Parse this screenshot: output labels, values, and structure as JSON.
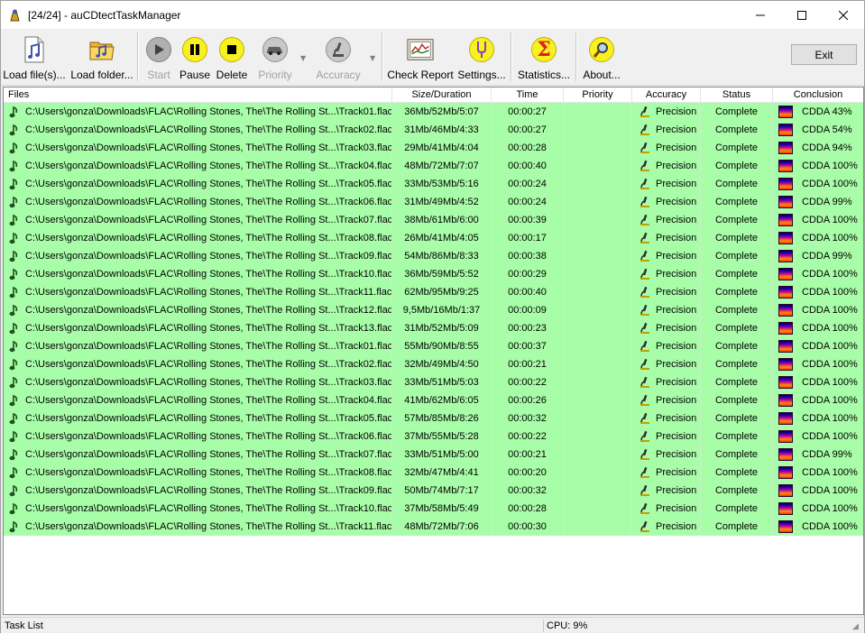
{
  "window": {
    "title": "[24/24] - auCDtectTaskManager",
    "controls": [
      "minimize",
      "maximize",
      "close"
    ]
  },
  "toolbar": {
    "buttons": [
      {
        "label": "Load file(s)...",
        "icon": "music-file-icon",
        "enabled": true
      },
      {
        "label": "Load folder...",
        "icon": "music-folder-icon",
        "enabled": true
      },
      {
        "label": "Start",
        "icon": "play-icon",
        "enabled": false
      },
      {
        "label": "Pause",
        "icon": "pause-icon",
        "enabled": true
      },
      {
        "label": "Delete",
        "icon": "stop-icon",
        "enabled": true
      },
      {
        "label": "Priority",
        "icon": "car-icon",
        "enabled": false
      },
      {
        "label": "Accuracy",
        "icon": "microscope-icon",
        "enabled": false
      },
      {
        "label": "Check Report",
        "icon": "report-icon",
        "enabled": true
      },
      {
        "label": "Settings...",
        "icon": "tuning-fork-icon",
        "enabled": true
      },
      {
        "label": "Statistics...",
        "icon": "sigma-icon",
        "enabled": true
      },
      {
        "label": "About...",
        "icon": "magnifier-icon",
        "enabled": true
      }
    ],
    "exit_label": "Exit"
  },
  "list": {
    "columns": [
      "Files",
      "Size/Duration",
      "Time",
      "Priority",
      "Accuracy",
      "Status",
      "Conclusion"
    ],
    "rows": [
      {
        "file": "C:\\Users\\gonza\\Downloads\\FLAC\\Rolling Stones, The\\The Rolling St...\\Track01.flac",
        "size": "36Mb/52Mb/5:07",
        "time": "00:00:27",
        "priority": "",
        "accuracy": "Precision",
        "status": "Complete",
        "conclusion": "CDDA 43%"
      },
      {
        "file": "C:\\Users\\gonza\\Downloads\\FLAC\\Rolling Stones, The\\The Rolling St...\\Track02.flac",
        "size": "31Mb/46Mb/4:33",
        "time": "00:00:27",
        "priority": "",
        "accuracy": "Precision",
        "status": "Complete",
        "conclusion": "CDDA 54%"
      },
      {
        "file": "C:\\Users\\gonza\\Downloads\\FLAC\\Rolling Stones, The\\The Rolling St...\\Track03.flac",
        "size": "29Mb/41Mb/4:04",
        "time": "00:00:28",
        "priority": "",
        "accuracy": "Precision",
        "status": "Complete",
        "conclusion": "CDDA 94%"
      },
      {
        "file": "C:\\Users\\gonza\\Downloads\\FLAC\\Rolling Stones, The\\The Rolling St...\\Track04.flac",
        "size": "48Mb/72Mb/7:07",
        "time": "00:00:40",
        "priority": "",
        "accuracy": "Precision",
        "status": "Complete",
        "conclusion": "CDDA 100%"
      },
      {
        "file": "C:\\Users\\gonza\\Downloads\\FLAC\\Rolling Stones, The\\The Rolling St...\\Track05.flac",
        "size": "33Mb/53Mb/5:16",
        "time": "00:00:24",
        "priority": "",
        "accuracy": "Precision",
        "status": "Complete",
        "conclusion": "CDDA 100%"
      },
      {
        "file": "C:\\Users\\gonza\\Downloads\\FLAC\\Rolling Stones, The\\The Rolling St...\\Track06.flac",
        "size": "31Mb/49Mb/4:52",
        "time": "00:00:24",
        "priority": "",
        "accuracy": "Precision",
        "status": "Complete",
        "conclusion": "CDDA 99%"
      },
      {
        "file": "C:\\Users\\gonza\\Downloads\\FLAC\\Rolling Stones, The\\The Rolling St...\\Track07.flac",
        "size": "38Mb/61Mb/6:00",
        "time": "00:00:39",
        "priority": "",
        "accuracy": "Precision",
        "status": "Complete",
        "conclusion": "CDDA 100%"
      },
      {
        "file": "C:\\Users\\gonza\\Downloads\\FLAC\\Rolling Stones, The\\The Rolling St...\\Track08.flac",
        "size": "26Mb/41Mb/4:05",
        "time": "00:00:17",
        "priority": "",
        "accuracy": "Precision",
        "status": "Complete",
        "conclusion": "CDDA 100%"
      },
      {
        "file": "C:\\Users\\gonza\\Downloads\\FLAC\\Rolling Stones, The\\The Rolling St...\\Track09.flac",
        "size": "54Mb/86Mb/8:33",
        "time": "00:00:38",
        "priority": "",
        "accuracy": "Precision",
        "status": "Complete",
        "conclusion": "CDDA 99%"
      },
      {
        "file": "C:\\Users\\gonza\\Downloads\\FLAC\\Rolling Stones, The\\The Rolling St...\\Track10.flac",
        "size": "36Mb/59Mb/5:52",
        "time": "00:00:29",
        "priority": "",
        "accuracy": "Precision",
        "status": "Complete",
        "conclusion": "CDDA 100%"
      },
      {
        "file": "C:\\Users\\gonza\\Downloads\\FLAC\\Rolling Stones, The\\The Rolling St...\\Track11.flac",
        "size": "62Mb/95Mb/9:25",
        "time": "00:00:40",
        "priority": "",
        "accuracy": "Precision",
        "status": "Complete",
        "conclusion": "CDDA 100%"
      },
      {
        "file": "C:\\Users\\gonza\\Downloads\\FLAC\\Rolling Stones, The\\The Rolling St...\\Track12.flac",
        "size": "9,5Mb/16Mb/1:37",
        "time": "00:00:09",
        "priority": "",
        "accuracy": "Precision",
        "status": "Complete",
        "conclusion": "CDDA 100%"
      },
      {
        "file": "C:\\Users\\gonza\\Downloads\\FLAC\\Rolling Stones, The\\The Rolling St...\\Track13.flac",
        "size": "31Mb/52Mb/5:09",
        "time": "00:00:23",
        "priority": "",
        "accuracy": "Precision",
        "status": "Complete",
        "conclusion": "CDDA 100%"
      },
      {
        "file": "C:\\Users\\gonza\\Downloads\\FLAC\\Rolling Stones, The\\The Rolling St...\\Track01.flac",
        "size": "55Mb/90Mb/8:55",
        "time": "00:00:37",
        "priority": "",
        "accuracy": "Precision",
        "status": "Complete",
        "conclusion": "CDDA 100%"
      },
      {
        "file": "C:\\Users\\gonza\\Downloads\\FLAC\\Rolling Stones, The\\The Rolling St...\\Track02.flac",
        "size": "32Mb/49Mb/4:50",
        "time": "00:00:21",
        "priority": "",
        "accuracy": "Precision",
        "status": "Complete",
        "conclusion": "CDDA 100%"
      },
      {
        "file": "C:\\Users\\gonza\\Downloads\\FLAC\\Rolling Stones, The\\The Rolling St...\\Track03.flac",
        "size": "33Mb/51Mb/5:03",
        "time": "00:00:22",
        "priority": "",
        "accuracy": "Precision",
        "status": "Complete",
        "conclusion": "CDDA 100%"
      },
      {
        "file": "C:\\Users\\gonza\\Downloads\\FLAC\\Rolling Stones, The\\The Rolling St...\\Track04.flac",
        "size": "41Mb/62Mb/6:05",
        "time": "00:00:26",
        "priority": "",
        "accuracy": "Precision",
        "status": "Complete",
        "conclusion": "CDDA 100%"
      },
      {
        "file": "C:\\Users\\gonza\\Downloads\\FLAC\\Rolling Stones, The\\The Rolling St...\\Track05.flac",
        "size": "57Mb/85Mb/8:26",
        "time": "00:00:32",
        "priority": "",
        "accuracy": "Precision",
        "status": "Complete",
        "conclusion": "CDDA 100%"
      },
      {
        "file": "C:\\Users\\gonza\\Downloads\\FLAC\\Rolling Stones, The\\The Rolling St...\\Track06.flac",
        "size": "37Mb/55Mb/5:28",
        "time": "00:00:22",
        "priority": "",
        "accuracy": "Precision",
        "status": "Complete",
        "conclusion": "CDDA 100%"
      },
      {
        "file": "C:\\Users\\gonza\\Downloads\\FLAC\\Rolling Stones, The\\The Rolling St...\\Track07.flac",
        "size": "33Mb/51Mb/5:00",
        "time": "00:00:21",
        "priority": "",
        "accuracy": "Precision",
        "status": "Complete",
        "conclusion": "CDDA 99%"
      },
      {
        "file": "C:\\Users\\gonza\\Downloads\\FLAC\\Rolling Stones, The\\The Rolling St...\\Track08.flac",
        "size": "32Mb/47Mb/4:41",
        "time": "00:00:20",
        "priority": "",
        "accuracy": "Precision",
        "status": "Complete",
        "conclusion": "CDDA 100%"
      },
      {
        "file": "C:\\Users\\gonza\\Downloads\\FLAC\\Rolling Stones, The\\The Rolling St...\\Track09.flac",
        "size": "50Mb/74Mb/7:17",
        "time": "00:00:32",
        "priority": "",
        "accuracy": "Precision",
        "status": "Complete",
        "conclusion": "CDDA 100%"
      },
      {
        "file": "C:\\Users\\gonza\\Downloads\\FLAC\\Rolling Stones, The\\The Rolling St...\\Track10.flac",
        "size": "37Mb/58Mb/5:49",
        "time": "00:00:28",
        "priority": "",
        "accuracy": "Precision",
        "status": "Complete",
        "conclusion": "CDDA 100%"
      },
      {
        "file": "C:\\Users\\gonza\\Downloads\\FLAC\\Rolling Stones, The\\The Rolling St...\\Track11.flac",
        "size": "48Mb/72Mb/7:06",
        "time": "00:00:30",
        "priority": "",
        "accuracy": "Precision",
        "status": "Complete",
        "conclusion": "CDDA 100%"
      }
    ],
    "row_color": "#a8fda8"
  },
  "statusbar": {
    "left": "Task List",
    "cpu": "CPU: 9%"
  }
}
